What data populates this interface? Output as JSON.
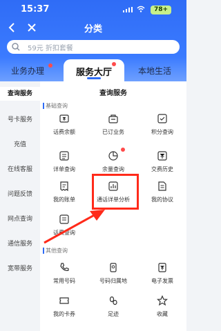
{
  "status": {
    "time": "15:37",
    "battery": "78+"
  },
  "nav": {
    "title": "分类"
  },
  "search": {
    "placeholder": "59元 折扣套餐"
  },
  "tabs": [
    {
      "label": "业务办理"
    },
    {
      "label": "服务大厅"
    },
    {
      "label": "本地生活"
    }
  ],
  "sidebar": {
    "items": [
      {
        "label": "查询服务"
      },
      {
        "label": "号卡服务"
      },
      {
        "label": "充值"
      },
      {
        "label": "在线客服"
      },
      {
        "label": "问题反馈"
      },
      {
        "label": "网点查询"
      },
      {
        "label": "通信服务"
      },
      {
        "label": "宽带服务"
      }
    ]
  },
  "content": {
    "heading": "查询服务",
    "basic_title": "基础查询",
    "basic_items": [
      {
        "label": "话费余额",
        "icon": "wallet-icon"
      },
      {
        "label": "已订业务",
        "icon": "bag-icon"
      },
      {
        "label": "积分查询",
        "icon": "points-icon"
      },
      {
        "label": "详单查询",
        "icon": "list-icon"
      },
      {
        "label": "余量查询",
        "icon": "pie-icon"
      },
      {
        "label": "交费历史",
        "icon": "history-icon"
      },
      {
        "label": "我的账单",
        "icon": "bill-icon"
      },
      {
        "label": "通话详单分析",
        "icon": "analysis-icon"
      },
      {
        "label": "我的协议",
        "icon": "document-icon"
      },
      {
        "label": "话费查询",
        "icon": "fee-icon"
      }
    ],
    "other_title": "其他查询",
    "other_items": [
      {
        "label": "常用号码",
        "icon": "phone-icon"
      },
      {
        "label": "号码归属地",
        "icon": "location-icon"
      },
      {
        "label": "电子发票",
        "icon": "invoice-icon"
      },
      {
        "label": "我的卡券",
        "icon": "coupon-icon"
      },
      {
        "label": "足迹",
        "icon": "footprint-icon"
      },
      {
        "label": "收藏",
        "icon": "star-icon"
      }
    ]
  },
  "colors": {
    "brand": "#2f6cf6",
    "alert": "#ff2a1a",
    "badge": "#c7f08a"
  }
}
